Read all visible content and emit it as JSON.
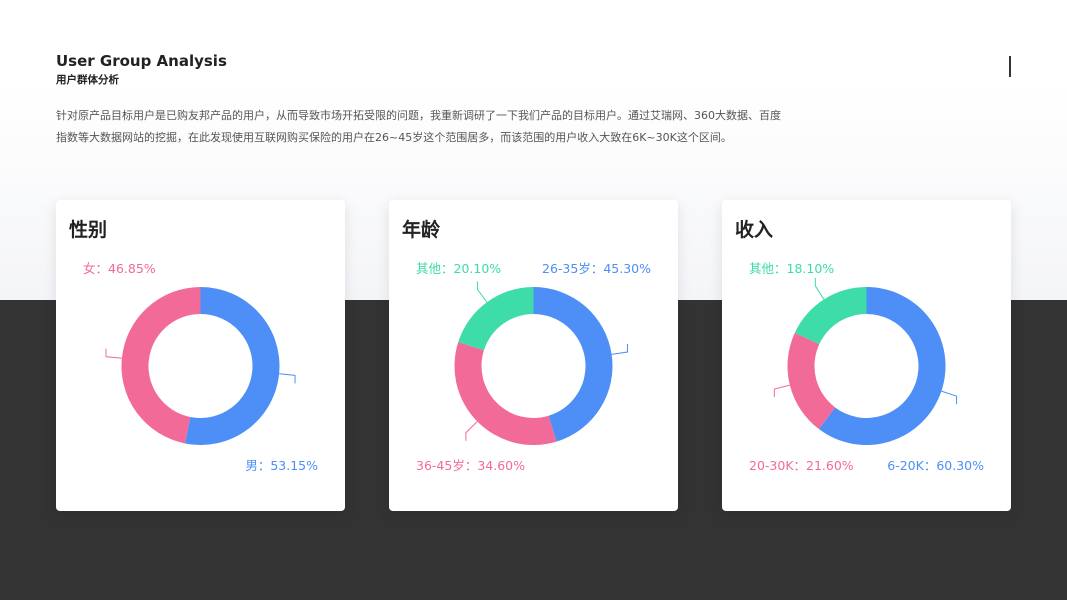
{
  "header": {
    "title_en": "User Group Analysis",
    "title_cn": "用户群体分析"
  },
  "description": {
    "line1": "针对原产品目标用户是已购友邦产品的用户，从而导致市场开拓受限的问题，我重新调研了一下我们产品的目标用户。通过艾瑞网、360大数据、百度",
    "line2": "指数等大数据网站的挖掘，在此发现使用互联网购买保险的用户在26~45岁这个范围居多，而该范围的用户收入大致在6K~30K这个区间。"
  },
  "colors": {
    "blue": "#4d8ff7",
    "pink": "#f26b98",
    "green": "#3ddca8"
  },
  "chart_data": [
    {
      "type": "pie",
      "title": "性别",
      "slices": [
        {
          "label": "男",
          "value": 53.15,
          "text": "男：53.15%",
          "color": "#4d8ff7"
        },
        {
          "label": "女",
          "value": 46.85,
          "text": "女：46.85%",
          "color": "#f26b98"
        }
      ]
    },
    {
      "type": "pie",
      "title": "年龄",
      "slices": [
        {
          "label": "26-35岁",
          "value": 45.3,
          "text": "26-35岁：45.30%",
          "color": "#4d8ff7"
        },
        {
          "label": "36-45岁",
          "value": 34.6,
          "text": "36-45岁：34.60%",
          "color": "#f26b98"
        },
        {
          "label": "其他",
          "value": 20.1,
          "text": "其他：20.10%",
          "color": "#3ddca8"
        }
      ]
    },
    {
      "type": "pie",
      "title": "收入",
      "slices": [
        {
          "label": "6-20K",
          "value": 60.3,
          "text": "6-20K：60.30%",
          "color": "#4d8ff7"
        },
        {
          "label": "20-30K",
          "value": 21.6,
          "text": "20-30K：21.60%",
          "color": "#f26b98"
        },
        {
          "label": "其他",
          "value": 18.1,
          "text": "其他：18.10%",
          "color": "#3ddca8"
        }
      ]
    }
  ]
}
